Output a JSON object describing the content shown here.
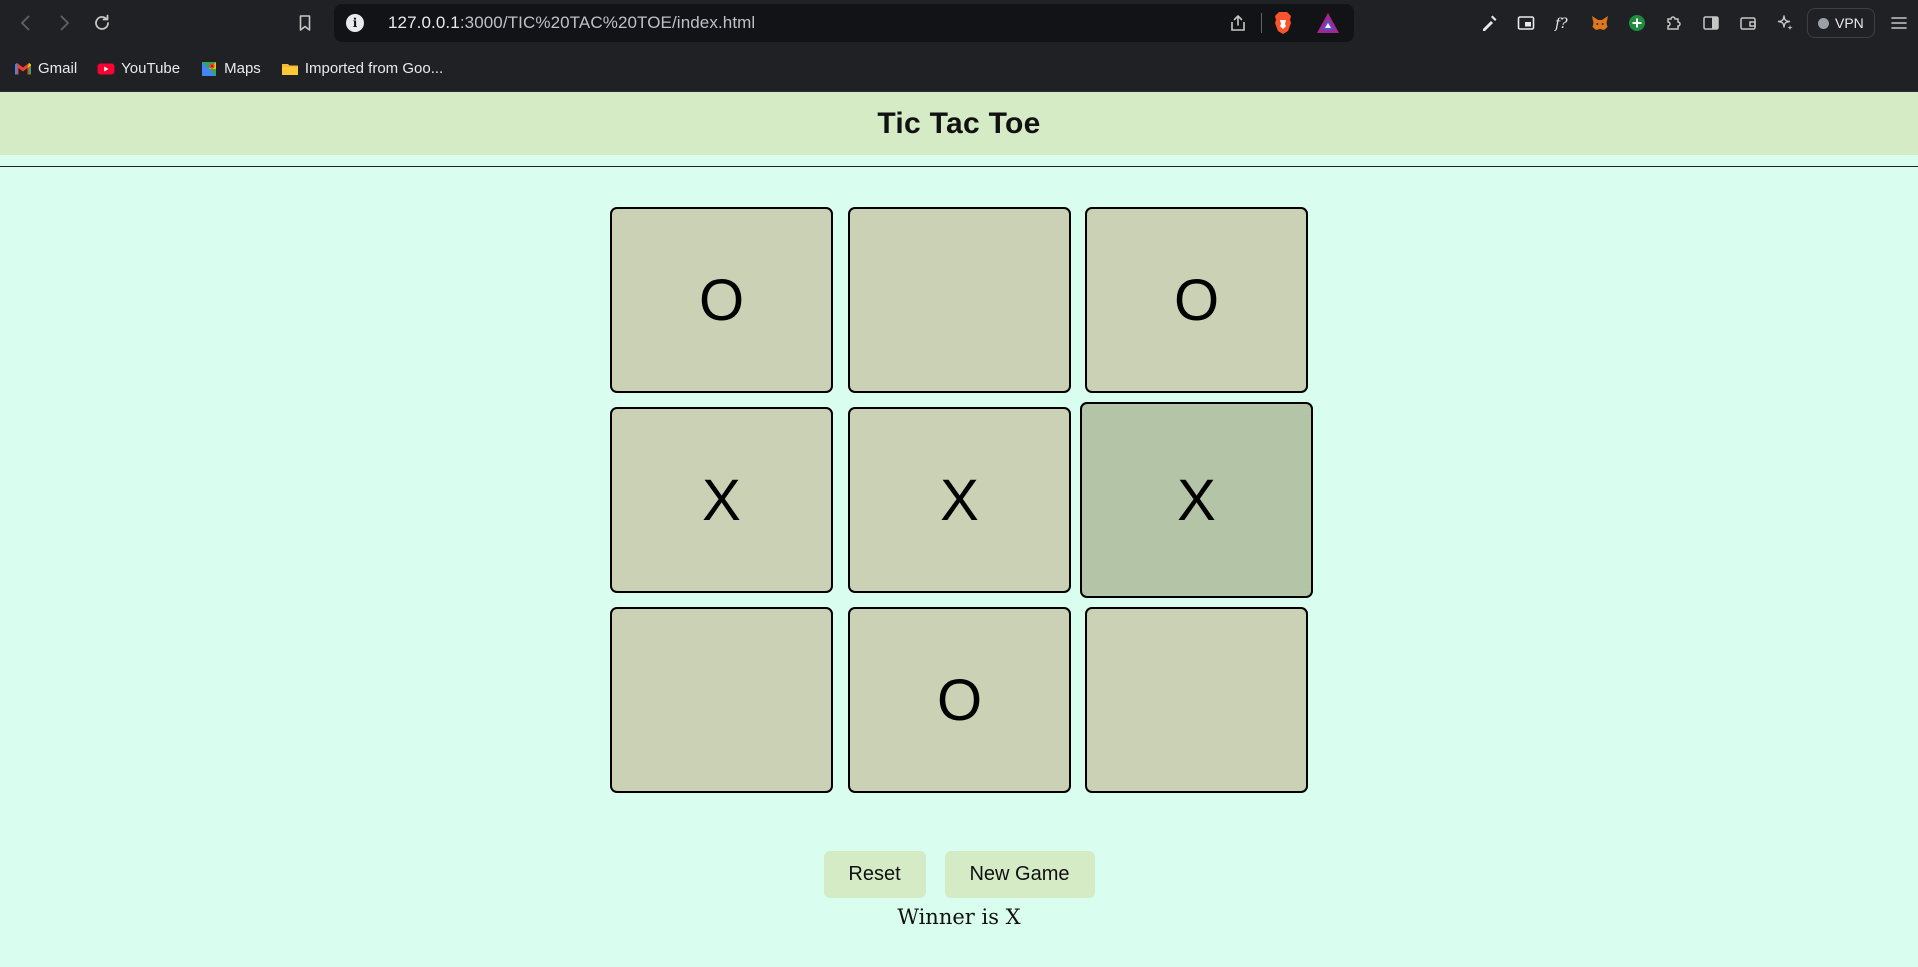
{
  "browser": {
    "url_host": "127.0.0.1",
    "url_path": ":3000/TIC%20TAC%20TOE/index.html",
    "vpn_label": "VPN",
    "bookmarks": [
      {
        "label": "Gmail",
        "icon": "gmail-icon"
      },
      {
        "label": "YouTube",
        "icon": "youtube-icon"
      },
      {
        "label": "Maps",
        "icon": "maps-icon"
      },
      {
        "label": "Imported from Goo...",
        "icon": "folder-icon"
      }
    ]
  },
  "page": {
    "title": "Tic Tac Toe"
  },
  "board": {
    "cells": [
      "O",
      "",
      "O",
      "X",
      "X",
      "X",
      "",
      "O",
      ""
    ],
    "highlighted_cell": 5
  },
  "controls": {
    "reset_label": "Reset",
    "new_game_label": "New Game"
  },
  "status": {
    "message": "Winner is X"
  },
  "colors": {
    "page_bg": "#d9fdee",
    "header_bg": "#d4ebc6",
    "cell_bg": "#cad1b4",
    "cell_highlight_bg": "#b4c4a6",
    "button_bg": "#d4ebc6"
  }
}
